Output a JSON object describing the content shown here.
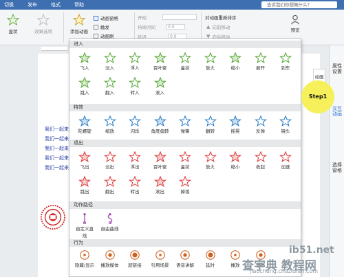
{
  "menu": {
    "items": [
      "切换",
      "发布",
      "格式",
      "帮助"
    ],
    "tell_me": "告诉我们你想做什么？"
  },
  "ribbon": {
    "btn_box": "盒状",
    "btn_effect_options": "效果选项",
    "btn_add_animation": "添加动画",
    "animation_pane": "动画窗格",
    "trigger": "触发",
    "animation_painter": "动画刷",
    "start_label": "开始",
    "duration_label": "持续时间",
    "delay_label": "延迟",
    "duration_value": "0.0",
    "delay_value": "0.0",
    "reorder_title": "对动画重新排序",
    "move_earlier": "向前移动",
    "move_later": "向后移动",
    "preview": "预览"
  },
  "popup": {
    "sections": {
      "entrance": "进入",
      "emphasis": "特效",
      "exit": "退出",
      "motion": "动作路径",
      "action": "行为"
    },
    "entrance_effects": [
      "飞入",
      "淡入",
      "浮入",
      "百叶窗",
      "盒状",
      "放大",
      "缩小",
      "展开",
      "到车",
      "跳入",
      "翻入",
      "转入",
      "滚入"
    ],
    "emphasis_effects": [
      "陀螺旋",
      "缩放",
      "闪烁",
      "角度偏转",
      "弹簧",
      "翻转",
      "摇晃",
      "反弹",
      "镜头"
    ],
    "exit_effects": [
      "飞出",
      "淡出",
      "浮出",
      "百叶窗",
      "盒状",
      "放大",
      "缩小",
      "收起",
      "加速",
      "跳出",
      "翻出",
      "转出",
      "滚出",
      "掉落"
    ],
    "motion_effects": [
      "自定义直线",
      "自由曲线"
    ],
    "action_effects": [
      "隐藏/显示",
      "播放媒体",
      "超链接",
      "引用场景",
      "语音讲解",
      "延时",
      "播放",
      "暂停"
    ]
  },
  "document": {
    "lines": [
      "我们一起来",
      "我们一起来",
      "我们一起来",
      "我们一起来",
      "我们一起来"
    ],
    "line_color": "#2a3ea8"
  },
  "right_panel": {
    "anim_tab": "动画",
    "items": [
      "属性设置",
      "交互动画",
      "选择窗格"
    ]
  },
  "annotation": {
    "step": "Step1"
  },
  "watermark": {
    "line1": "ib51.net",
    "line2": "查字典 教程网",
    "line3": "jiaocheng.chazidian.com"
  },
  "colors": {
    "entrance": "#5aaa3a",
    "emphasis": "#2f80c8",
    "exit": "#e04040",
    "motion": "#a040b0",
    "action": "#d06020",
    "menubar": "#3d6fb1"
  }
}
